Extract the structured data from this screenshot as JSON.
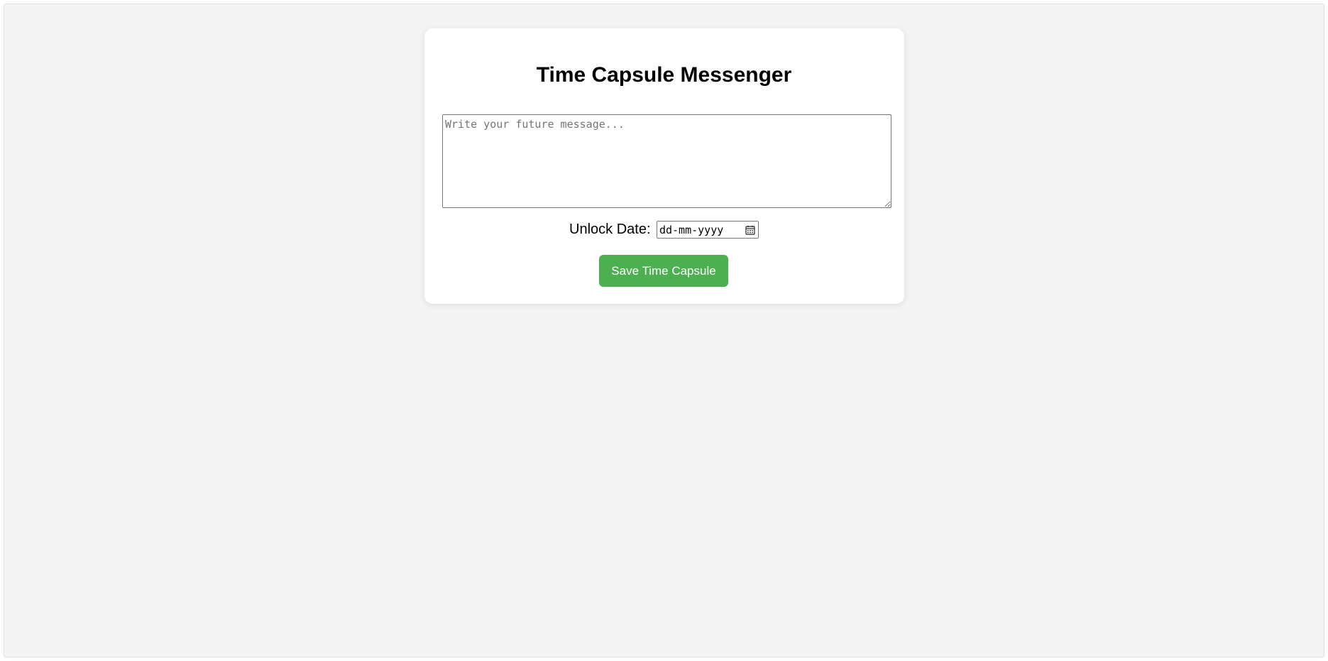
{
  "app": {
    "title": "Time Capsule Messenger"
  },
  "form": {
    "message": {
      "placeholder": "Write your future message...",
      "value": ""
    },
    "unlock_date": {
      "label": "Unlock Date:",
      "placeholder": "dd-mm-yyyy",
      "icon": "calendar-icon"
    },
    "save_label": "Save Time Capsule"
  },
  "colors": {
    "background": "#f4f4f4",
    "card": "#ffffff",
    "accent": "#4caf50"
  }
}
